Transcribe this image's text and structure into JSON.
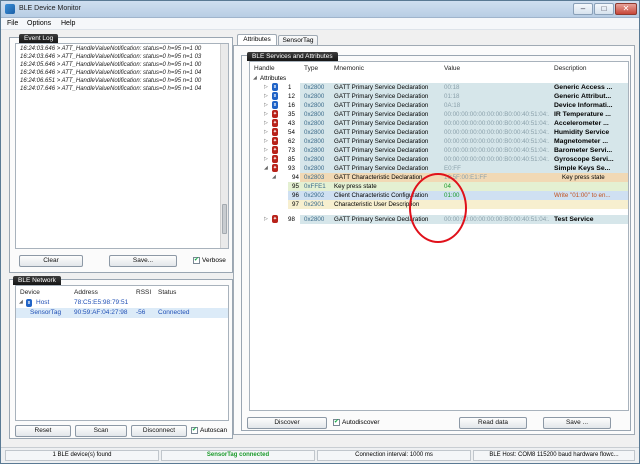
{
  "window": {
    "title": "BLE Device Monitor",
    "minimize_glyph": "–",
    "maximize_glyph": "□",
    "close_glyph": "✕"
  },
  "menu": [
    "File",
    "Options",
    "Help"
  ],
  "event_log": {
    "title": "Event Log",
    "lines": [
      "16:24:03.646 > ATT_HandleValueNotification: status=0 h=95 n=1 00",
      "16:24:03.646 > ATT_HandleValueNotification: status=0 h=95 n=1 03",
      "16:24:05.646 > ATT_HandleValueNotification: status=0 h=95 n=1 00",
      "16:24:06.646 > ATT_HandleValueNotification: status=0 h=95 n=1 04",
      "16:24:06.651 > ATT_HandleValueNotification: status=0 h=95 n=1 00",
      "16:24:07.646 > ATT_HandleValueNotification: status=0 h=95 n=1 04"
    ],
    "clear_label": "Clear",
    "save_label": "Save...",
    "verbose_label": "Verbose",
    "verbose_checked": "✔"
  },
  "ble_network": {
    "title": "BLE Network",
    "columns": [
      "Device",
      "Address",
      "RSSI",
      "Status"
    ],
    "rows": [
      {
        "device": "Host",
        "address": "78:C5:E5:98:79:51",
        "rssi": "",
        "status": ""
      },
      {
        "device": "SensorTag",
        "address": "90:59:AF:04:27:98",
        "rssi": "-56",
        "status": "Connected"
      }
    ],
    "reset_label": "Reset",
    "scan_label": "Scan",
    "disconnect_label": "Disconnect",
    "autoscan_label": "Autoscan",
    "autoscan_checked": "✔"
  },
  "tabs": [
    "Attributes",
    "SensorTag"
  ],
  "services": {
    "title": "BLE Services and Attributes",
    "columns": [
      "Handle",
      "Type",
      "Mnemonic",
      "Value",
      "Description"
    ],
    "root_label": "Attributes",
    "rows": [
      {
        "handle": "1",
        "type": "0x2800",
        "mnemonic": "GATT Primary Service Declaration",
        "value": "00:18",
        "description": "Generic Access ...",
        "kind": "service"
      },
      {
        "handle": "12",
        "type": "0x2800",
        "mnemonic": "GATT Primary Service Declaration",
        "value": "01:18",
        "description": "Generic Attribut...",
        "kind": "service"
      },
      {
        "handle": "16",
        "type": "0x2800",
        "mnemonic": "GATT Primary Service Declaration",
        "value": "0A:18",
        "description": "Device Informati...",
        "kind": "service"
      },
      {
        "handle": "35",
        "type": "0x2800",
        "mnemonic": "GATT Primary Service Declaration",
        "value": "00:00:00:00:00:00:00:B0:00:40:51:04:...",
        "description": "IR Temperature ...",
        "kind": "service"
      },
      {
        "handle": "43",
        "type": "0x2800",
        "mnemonic": "GATT Primary Service Declaration",
        "value": "00:00:00:00:00:00:00:B0:00:40:51:04:...",
        "description": "Accelerometer ...",
        "kind": "service"
      },
      {
        "handle": "54",
        "type": "0x2800",
        "mnemonic": "GATT Primary Service Declaration",
        "value": "00:00:00:00:00:00:00:B0:00:40:51:04:...",
        "description": "Humidity Service",
        "kind": "service"
      },
      {
        "handle": "62",
        "type": "0x2800",
        "mnemonic": "GATT Primary Service Declaration",
        "value": "00:00:00:00:00:00:00:B0:00:40:51:04:...",
        "description": "Magnetometer ...",
        "kind": "service"
      },
      {
        "handle": "73",
        "type": "0x2800",
        "mnemonic": "GATT Primary Service Declaration",
        "value": "00:00:00:00:00:00:00:B0:00:40:51:04:...",
        "description": "Barometer Servi...",
        "kind": "service"
      },
      {
        "handle": "85",
        "type": "0x2800",
        "mnemonic": "GATT Primary Service Declaration",
        "value": "00:00:00:00:00:00:00:B0:00:40:51:04:...",
        "description": "Gyroscope Servi...",
        "kind": "service"
      },
      {
        "handle": "93",
        "type": "0x2800",
        "mnemonic": "GATT Primary Service Declaration",
        "value": "E0:FF",
        "description": "Simple Keys Se...",
        "kind": "service"
      },
      {
        "handle": "94",
        "type": "0x2803",
        "mnemonic": "GATT Characteristic Declaration",
        "value": "10:5F:00:E1:FF",
        "description": "Key press state",
        "kind": "char-decl"
      },
      {
        "handle": "95",
        "type": "0xFFE1",
        "mnemonic": "Key press state",
        "value": "04",
        "description": "",
        "kind": "char-value"
      },
      {
        "handle": "96",
        "type": "0x2902",
        "mnemonic": "Client Characteristic Configuration",
        "value": "01:00",
        "description": "Write \"01:00\" to en...",
        "kind": "char-config"
      },
      {
        "handle": "97",
        "type": "0x2901",
        "mnemonic": "Characteristic User Description",
        "value": "",
        "description": "",
        "kind": "char-desc"
      },
      {
        "handle": "98",
        "type": "0x2800",
        "mnemonic": "GATT Primary Service Declaration",
        "value": "00:00:00:00:00:00:00:B0:00:40:51:04:...",
        "description": "Test Service",
        "kind": "service"
      }
    ],
    "discover_label": "Discover",
    "autodiscover_label": "Autodiscover",
    "autodiscover_checked": "✔",
    "read_data_label": "Read data",
    "save_label": "Save ..."
  },
  "status_bar": {
    "devices_found": "1 BLE device(s) found",
    "connection": "SensorTag connected",
    "interval": "Connection interval: 1000 ms",
    "host": "BLE Host: COM8 115200 baud hardware flowc..."
  },
  "colors": {
    "service_row": "#d6e6ea",
    "char_decl_row": "#f1d9b5",
    "char_value_row": "#e4f0d2",
    "char_config_row": "#cfe0f2",
    "char_desc_row": "#f7efcf",
    "connected_green": "#1a9a2a",
    "annotation_red": "#e0111b"
  }
}
